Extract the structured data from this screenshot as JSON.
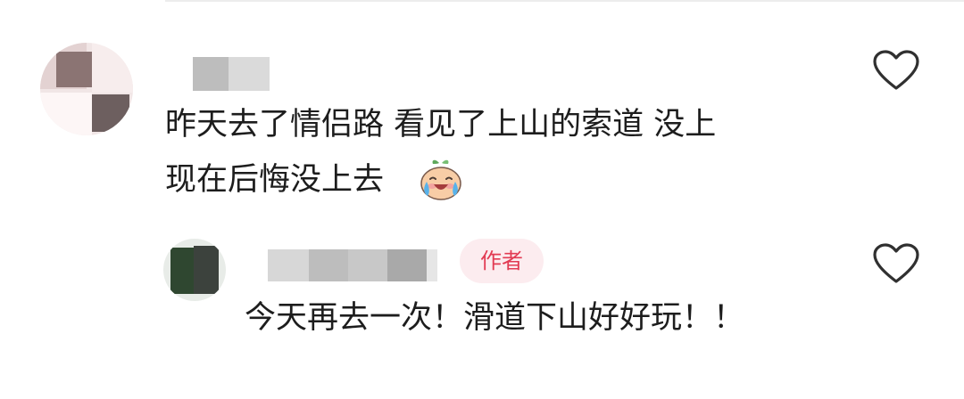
{
  "comment": {
    "text_line_1": "昨天去了情侣路 看见了上山的索道  没上",
    "text_line_2": "现在后悔没上去",
    "emoji_icon": "crying-laughing-emoji",
    "like_icon": "heart-outline-icon"
  },
  "reply": {
    "badge": "作者",
    "text": "今天再去一次！滑道下山好好玩！！",
    "like_icon": "heart-outline-icon"
  },
  "colors": {
    "badge_text": "#e23b53",
    "badge_bg": "#fcecef",
    "text": "#1d1d1d",
    "icon": "#303030"
  }
}
